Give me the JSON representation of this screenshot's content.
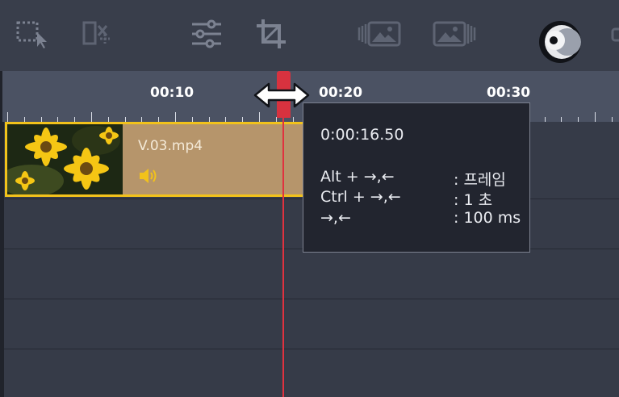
{
  "toolbar": {
    "icons": [
      "marquee-select-icon",
      "delete-gap-icon",
      "adjust-settings-icon",
      "crop-icon",
      "fade-in-image-icon",
      "fade-out-image-icon",
      "motion-tracking-icon"
    ]
  },
  "ruler": {
    "labels": [
      "00:10",
      "00:20",
      "00:30"
    ]
  },
  "clip": {
    "name": "V.03.mp4",
    "selected_color": "#f2c21b"
  },
  "playhead": {
    "color": "#e0323f"
  },
  "tooltip": {
    "time": "0:00:16.50",
    "rows": [
      {
        "keys": "Alt + →,←",
        "value": ": 프레임"
      },
      {
        "keys": "Ctrl + →,←",
        "value": ": 1 초"
      },
      {
        "keys": "→,←",
        "value": ": 100 ms"
      }
    ]
  }
}
